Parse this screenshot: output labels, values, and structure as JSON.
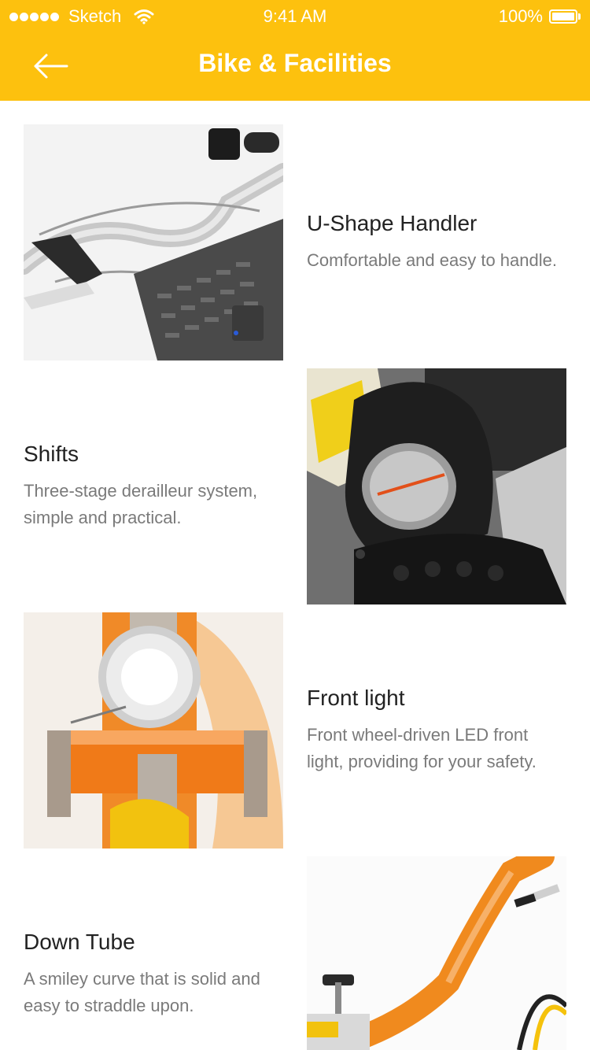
{
  "status_bar": {
    "carrier": "Sketch",
    "time": "9:41 AM",
    "battery": "100%"
  },
  "nav": {
    "title": "Bike & Facilities",
    "back_icon": "arrow-left-icon"
  },
  "colors": {
    "header": "#FDC10E",
    "title_text": "#222222",
    "desc_text": "#7A7A7A",
    "bike_orange": "#F28A1E"
  },
  "features": [
    {
      "title": "U-Shape Handler",
      "description": "Comfortable and easy to handle.",
      "image": "handlebar-photo"
    },
    {
      "title": "Shifts",
      "description": "Three-stage derailleur system, simple and practical.",
      "image": "gear-shifter-photo"
    },
    {
      "title": "Front light",
      "description": "Front wheel-driven LED front light, providing for your safety.",
      "image": "front-light-photo"
    },
    {
      "title": "Down Tube",
      "description": "A smiley curve that is solid and easy to straddle upon.",
      "image": "down-tube-photo"
    }
  ]
}
